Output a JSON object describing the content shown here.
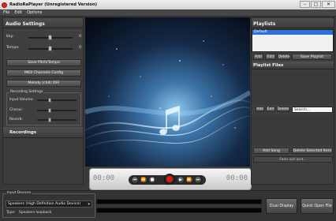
{
  "window": {
    "title": "RadioRaPlayer (Unregistered Version)",
    "minimize": "–",
    "maximize": "□",
    "close": "✕"
  },
  "menu": [
    "File",
    "Edit",
    "Options"
  ],
  "audio_settings": {
    "title": "Audio Settings",
    "key_label": "Key:",
    "key_value": "0",
    "tempo_label": "Tempo:",
    "tempo_value": "0",
    "save_pitch_button": "Save Pitch/Tempo",
    "midi_button": "MIDI Channels Config",
    "melody_button": "Melody (ch4) OFF"
  },
  "recording_settings": {
    "title": "Recording Settings",
    "input_volume_label": "Input Volume:",
    "chorus_label": "Chorus:",
    "reverb_label": "Reverb:"
  },
  "recordings": {
    "title": "Recordings"
  },
  "player": {
    "time_left": "00:00",
    "time_right": "00:00"
  },
  "playlists": {
    "title": "Playlists",
    "selected": "Default",
    "add_button": "Add",
    "edit_button": "Edit",
    "delete_button": "Delete",
    "save_button": "Save Playlist"
  },
  "playlist_files": {
    "title": "Playlist Files",
    "add_button": "Add",
    "edit_button": "Edit",
    "delete_button": "Delete",
    "search_placeholder": "Search...",
    "add_song_button": "Add Song",
    "delete_selected_button": "Delete Selected Item",
    "fade_label": "Fade out and..."
  },
  "input_devices": {
    "title": "Input Devices",
    "device": "Speakers (High Definition Audio Device)",
    "type_label": "Type:",
    "type_value": "Speakers loopback"
  },
  "bottom_buttons": {
    "dual_display": "Dual Display",
    "quick_open": "Quick Open File"
  },
  "colors": {
    "accent_selection": "#2f6fd6",
    "record": "#e01818"
  }
}
